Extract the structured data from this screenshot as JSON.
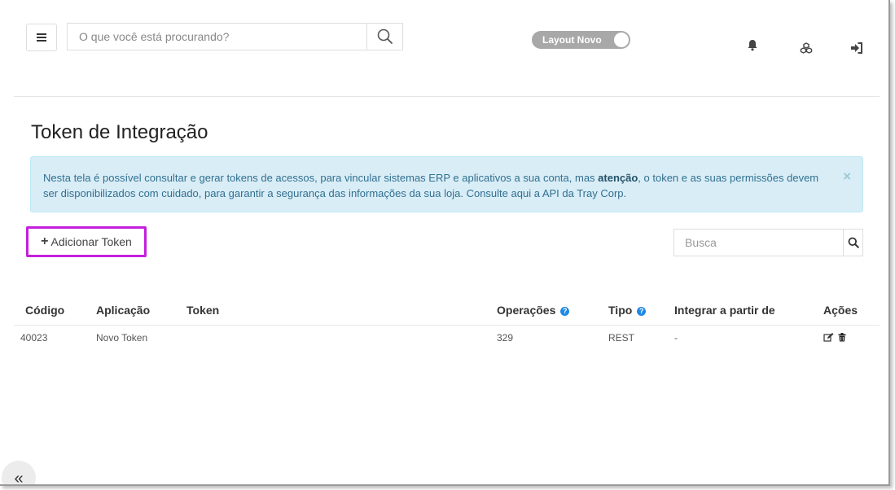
{
  "header": {
    "search_placeholder": "O que você está procurando?",
    "layout_toggle_label": "Layout Novo",
    "icons": [
      "menu-icon",
      "search-icon",
      "bell-icon",
      "apps-icon",
      "sign-out-icon"
    ]
  },
  "page": {
    "title": "Token de Integração"
  },
  "alert": {
    "text_before": "Nesta tela é possível consultar e gerar tokens de acessos, para vincular sistemas ERP e aplicativos a sua conta, mas ",
    "emphasis": "atenção",
    "text_middle": ", o token e as suas permissões devem ser disponibilizados com cuidado, para garantir a segurança das informações da sua loja. ",
    "link_text": "Consulte aqui",
    "text_after": " a API da Tray Corp.",
    "close_symbol": "×",
    "colors": {
      "background": "#d9edf7",
      "text": "#31708f"
    }
  },
  "actions": {
    "add_token_label": "Adicionar Token",
    "busca_placeholder": "Busca"
  },
  "table": {
    "columns": [
      "Código",
      "Aplicação",
      "Token",
      "Operações",
      "Tipo",
      "Integrar a partir de",
      "Ações"
    ],
    "rows": [
      {
        "codigo": "40023",
        "aplicacao": "Novo Token",
        "token": "",
        "operacoes": "329",
        "tipo": "REST",
        "integrar": "-",
        "acoes": [
          "edit-icon",
          "trash-icon"
        ]
      }
    ]
  },
  "sidebar_toggle": {
    "symbol": "«"
  },
  "colors": {
    "highlight_border": "#c41fdc",
    "help_icon": "#1e88e5"
  }
}
